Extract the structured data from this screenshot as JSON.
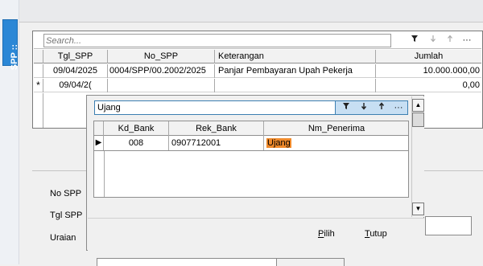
{
  "sidetab": {
    "label": "SPP ::",
    "top_label": "::"
  },
  "main": {
    "search_placeholder": "Search...",
    "toolbar": {
      "filter_icon": "filter-icon",
      "sort_desc_icon": "arrow-down-icon",
      "sort_asc_icon": "arrow-up-icon",
      "more_label": "···"
    },
    "columns": [
      "Tgl_SPP",
      "No_SPP",
      "Keterangan",
      "Jumlah"
    ],
    "rows": [
      {
        "indicator": "",
        "tgl": "09/04/2025",
        "no": "0004/SPP/00.2002/2025",
        "ket": "Panjar Pembayaran Upah Pekerja",
        "jumlah": "10.000.000,00"
      },
      {
        "indicator": "*",
        "tgl": "09/04/2(",
        "no": "",
        "ket": "",
        "jumlah": "0,00"
      }
    ]
  },
  "form": {
    "labels": [
      "No SPP",
      "Tgl SPP",
      "Uraian"
    ]
  },
  "lookup": {
    "search_value": "Ujang",
    "toolbar": {
      "filter_label": "▼",
      "down_label": "↓",
      "up_label": "↑",
      "more_label": "···"
    },
    "columns": [
      "Kd_Bank",
      "Rek_Bank",
      "Nm_Penerima"
    ],
    "row": {
      "indicator": "▶",
      "kd_bank": "008",
      "rek_bank": "0907712001",
      "nm_penerima": "Ujang"
    },
    "buttons": {
      "pilih_first": "P",
      "pilih_rest": "ilih",
      "tutup_first": "T",
      "tutup_rest": "utup"
    },
    "scroll": {
      "up_label": "▲",
      "down_label": "▼"
    }
  },
  "colors": {
    "accent": "#2b87d6",
    "highlight": "#f08a2b",
    "lookup_toolbar": "#c7dff3"
  }
}
